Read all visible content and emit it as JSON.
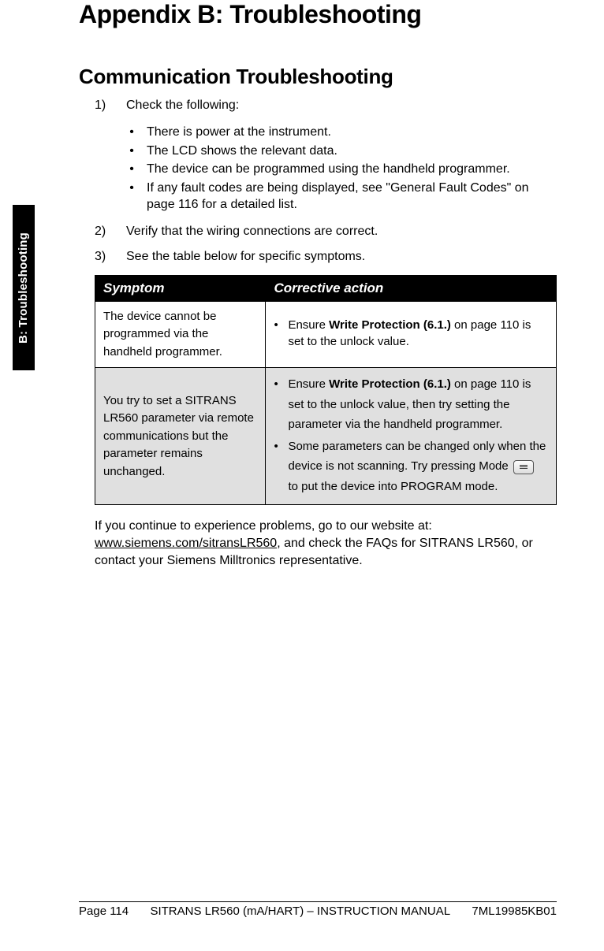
{
  "sideTab": "B: Troubleshooting",
  "title": "Appendix B: Troubleshooting",
  "sectionTitle": "Communication Troubleshooting",
  "steps": {
    "s1": {
      "marker": "1)",
      "text": "Check the following:"
    },
    "s2": {
      "marker": "2)",
      "text": "Verify that the wiring connections are correct."
    },
    "s3": {
      "marker": "3)",
      "text": "See the table below for specific symptoms."
    }
  },
  "checks": {
    "c1": "There is power at the instrument.",
    "c2": "The LCD shows the relevant data.",
    "c3": "The device can be programmed using the handheld programmer.",
    "c4": "If any fault codes are being displayed, see \"General Fault Codes\" on page 116 for a detailed list."
  },
  "table": {
    "headers": {
      "symptom": "Symptom",
      "action": "Corrective action"
    },
    "row1": {
      "symptom": "The device cannot be programmed via the handheld programmer.",
      "actionPrefix": "Ensure ",
      "actionBold": "Write Protection (6.1.)",
      "actionSuffix": " on page 110 is set to the unlock value."
    },
    "row2": {
      "symptom": "You try to set a SITRANS LR560 parameter via remote communications but the parameter remains unchanged.",
      "b1Prefix": "Ensure ",
      "b1Bold": "Write Protection (6.1.)",
      "b1Suffix": " on page 110 is set to the unlock value, then try setting the parameter via the handheld programmer.",
      "b2Prefix": "Some parameters can be changed only when the device is not scanning. Try pressing Mode ",
      "b2Suffix": " to put the device into PROGRAM mode."
    }
  },
  "closing": {
    "line1": "If you continue to experience problems, go to our website at:",
    "link": "www.siemens.com/sitransLR560",
    "line2Suffix": ", and check the FAQs for SITRANS LR560, or contact your Siemens Milltronics representative."
  },
  "footer": {
    "page": "Page 114",
    "center": "SITRANS LR560 (mA/HART) – INSTRUCTION MANUAL",
    "right": "7ML19985KB01"
  }
}
